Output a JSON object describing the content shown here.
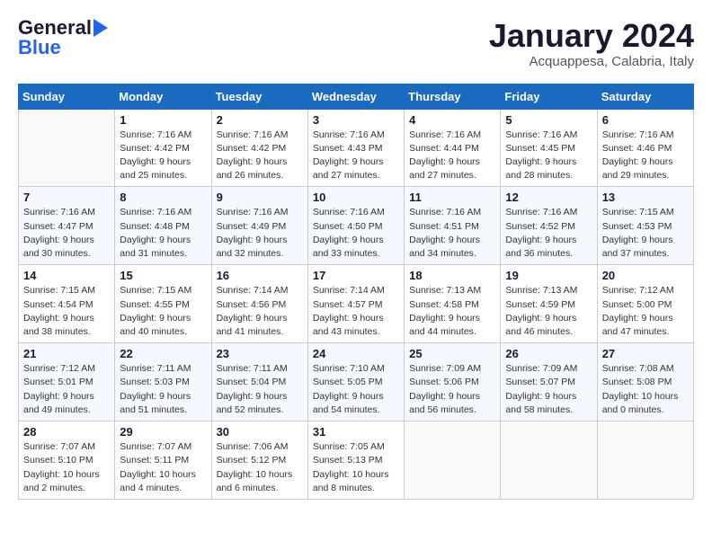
{
  "header": {
    "logo_line1": "General",
    "logo_line2": "Blue",
    "month": "January 2024",
    "location": "Acquappesa, Calabria, Italy"
  },
  "days_of_week": [
    "Sunday",
    "Monday",
    "Tuesday",
    "Wednesday",
    "Thursday",
    "Friday",
    "Saturday"
  ],
  "weeks": [
    [
      {
        "day": "",
        "info": ""
      },
      {
        "day": "1",
        "info": "Sunrise: 7:16 AM\nSunset: 4:42 PM\nDaylight: 9 hours\nand 25 minutes."
      },
      {
        "day": "2",
        "info": "Sunrise: 7:16 AM\nSunset: 4:42 PM\nDaylight: 9 hours\nand 26 minutes."
      },
      {
        "day": "3",
        "info": "Sunrise: 7:16 AM\nSunset: 4:43 PM\nDaylight: 9 hours\nand 27 minutes."
      },
      {
        "day": "4",
        "info": "Sunrise: 7:16 AM\nSunset: 4:44 PM\nDaylight: 9 hours\nand 27 minutes."
      },
      {
        "day": "5",
        "info": "Sunrise: 7:16 AM\nSunset: 4:45 PM\nDaylight: 9 hours\nand 28 minutes."
      },
      {
        "day": "6",
        "info": "Sunrise: 7:16 AM\nSunset: 4:46 PM\nDaylight: 9 hours\nand 29 minutes."
      }
    ],
    [
      {
        "day": "7",
        "info": "Sunrise: 7:16 AM\nSunset: 4:47 PM\nDaylight: 9 hours\nand 30 minutes."
      },
      {
        "day": "8",
        "info": "Sunrise: 7:16 AM\nSunset: 4:48 PM\nDaylight: 9 hours\nand 31 minutes."
      },
      {
        "day": "9",
        "info": "Sunrise: 7:16 AM\nSunset: 4:49 PM\nDaylight: 9 hours\nand 32 minutes."
      },
      {
        "day": "10",
        "info": "Sunrise: 7:16 AM\nSunset: 4:50 PM\nDaylight: 9 hours\nand 33 minutes."
      },
      {
        "day": "11",
        "info": "Sunrise: 7:16 AM\nSunset: 4:51 PM\nDaylight: 9 hours\nand 34 minutes."
      },
      {
        "day": "12",
        "info": "Sunrise: 7:16 AM\nSunset: 4:52 PM\nDaylight: 9 hours\nand 36 minutes."
      },
      {
        "day": "13",
        "info": "Sunrise: 7:15 AM\nSunset: 4:53 PM\nDaylight: 9 hours\nand 37 minutes."
      }
    ],
    [
      {
        "day": "14",
        "info": "Sunrise: 7:15 AM\nSunset: 4:54 PM\nDaylight: 9 hours\nand 38 minutes."
      },
      {
        "day": "15",
        "info": "Sunrise: 7:15 AM\nSunset: 4:55 PM\nDaylight: 9 hours\nand 40 minutes."
      },
      {
        "day": "16",
        "info": "Sunrise: 7:14 AM\nSunset: 4:56 PM\nDaylight: 9 hours\nand 41 minutes."
      },
      {
        "day": "17",
        "info": "Sunrise: 7:14 AM\nSunset: 4:57 PM\nDaylight: 9 hours\nand 43 minutes."
      },
      {
        "day": "18",
        "info": "Sunrise: 7:13 AM\nSunset: 4:58 PM\nDaylight: 9 hours\nand 44 minutes."
      },
      {
        "day": "19",
        "info": "Sunrise: 7:13 AM\nSunset: 4:59 PM\nDaylight: 9 hours\nand 46 minutes."
      },
      {
        "day": "20",
        "info": "Sunrise: 7:12 AM\nSunset: 5:00 PM\nDaylight: 9 hours\nand 47 minutes."
      }
    ],
    [
      {
        "day": "21",
        "info": "Sunrise: 7:12 AM\nSunset: 5:01 PM\nDaylight: 9 hours\nand 49 minutes."
      },
      {
        "day": "22",
        "info": "Sunrise: 7:11 AM\nSunset: 5:03 PM\nDaylight: 9 hours\nand 51 minutes."
      },
      {
        "day": "23",
        "info": "Sunrise: 7:11 AM\nSunset: 5:04 PM\nDaylight: 9 hours\nand 52 minutes."
      },
      {
        "day": "24",
        "info": "Sunrise: 7:10 AM\nSunset: 5:05 PM\nDaylight: 9 hours\nand 54 minutes."
      },
      {
        "day": "25",
        "info": "Sunrise: 7:09 AM\nSunset: 5:06 PM\nDaylight: 9 hours\nand 56 minutes."
      },
      {
        "day": "26",
        "info": "Sunrise: 7:09 AM\nSunset: 5:07 PM\nDaylight: 9 hours\nand 58 minutes."
      },
      {
        "day": "27",
        "info": "Sunrise: 7:08 AM\nSunset: 5:08 PM\nDaylight: 10 hours\nand 0 minutes."
      }
    ],
    [
      {
        "day": "28",
        "info": "Sunrise: 7:07 AM\nSunset: 5:10 PM\nDaylight: 10 hours\nand 2 minutes."
      },
      {
        "day": "29",
        "info": "Sunrise: 7:07 AM\nSunset: 5:11 PM\nDaylight: 10 hours\nand 4 minutes."
      },
      {
        "day": "30",
        "info": "Sunrise: 7:06 AM\nSunset: 5:12 PM\nDaylight: 10 hours\nand 6 minutes."
      },
      {
        "day": "31",
        "info": "Sunrise: 7:05 AM\nSunset: 5:13 PM\nDaylight: 10 hours\nand 8 minutes."
      },
      {
        "day": "",
        "info": ""
      },
      {
        "day": "",
        "info": ""
      },
      {
        "day": "",
        "info": ""
      }
    ]
  ]
}
